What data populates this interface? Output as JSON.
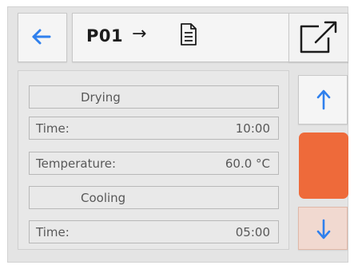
{
  "header": {
    "program_label": "P01",
    "arrow_glyph": "→",
    "back_icon": "arrow-left-icon",
    "document_icon": "document-icon",
    "external_icon": "open-external-icon"
  },
  "steps": [
    {
      "type": "section",
      "label": "Drying"
    },
    {
      "type": "field",
      "label": "Time:",
      "value": "10:00"
    },
    {
      "type": "field",
      "label": "Temperature:",
      "value": "60.0 °C"
    },
    {
      "type": "section",
      "label": "Cooling"
    },
    {
      "type": "field",
      "label": "Time:",
      "value": "05:00"
    }
  ],
  "scroll": {
    "up_icon": "arrow-up-icon",
    "down_icon": "arrow-down-icon"
  },
  "colors": {
    "accent_blue": "#2f80ed",
    "scroll_thumb": "#ee6a3a",
    "down_button_bg": "#f1d9d0"
  }
}
